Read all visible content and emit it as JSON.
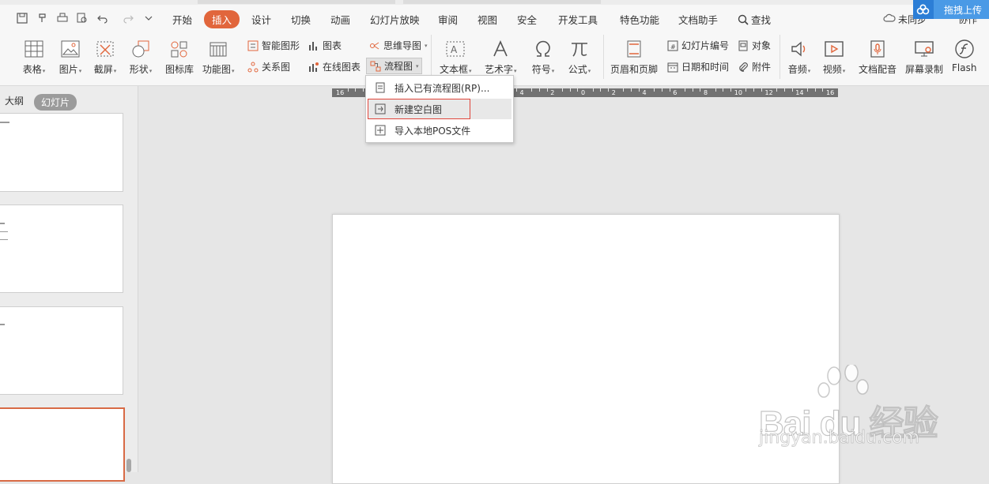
{
  "menu": {
    "items": [
      "开始",
      "插入",
      "设计",
      "切换",
      "动画",
      "幻灯片放映",
      "审阅",
      "视图",
      "安全",
      "开发工具",
      "特色功能",
      "文档助手"
    ],
    "active": "插入",
    "search_label": "查找",
    "right_text_1": "未同步",
    "right_text_2": "协作"
  },
  "upload_button": {
    "label": "拖拽上传"
  },
  "ribbon": {
    "table": "表格",
    "picture": "图片",
    "screenshot": "截屏",
    "shape": "形状",
    "icon_library": "图标库",
    "function_chart": "功能图",
    "smart_shape": "智能图形",
    "relation_chart": "关系图",
    "chart": "图表",
    "online_chart": "在线图表",
    "mind_map": "思维导图",
    "flowchart": "流程图",
    "textbox": "文本框",
    "art_text": "艺术字",
    "symbol": "符号",
    "formula": "公式",
    "header_footer": "页眉和页脚",
    "slide_number": "幻灯片编号",
    "date_time": "日期和时间",
    "object": "对象",
    "attachment": "附件",
    "audio": "音频",
    "video": "视频",
    "doc_voice": "文档配音",
    "screen_record": "屏幕录制",
    "flash": "Flash"
  },
  "flowchart_menu": {
    "items": [
      {
        "label": "插入已有流程图(RP)..."
      },
      {
        "label": "新建空白图"
      },
      {
        "label": "导入本地POS文件"
      }
    ],
    "highlighted_index": 1
  },
  "sidebar": {
    "tabs": [
      "大纲",
      "幻灯片"
    ],
    "active_tab": "幻灯片"
  },
  "ruler": {
    "labels": [
      "16",
      "14",
      "12",
      "10",
      "8",
      "6",
      "4",
      "2",
      "0",
      "2",
      "4",
      "6",
      "8",
      "10",
      "12",
      "14",
      "16"
    ]
  },
  "watermark": {
    "brand": "Bai du 经验",
    "url": "jingyan.baidu.com"
  },
  "colors": {
    "accent": "#e1663c",
    "highlight_border": "#e0453a",
    "upload_blue": "#4a9ae6"
  }
}
